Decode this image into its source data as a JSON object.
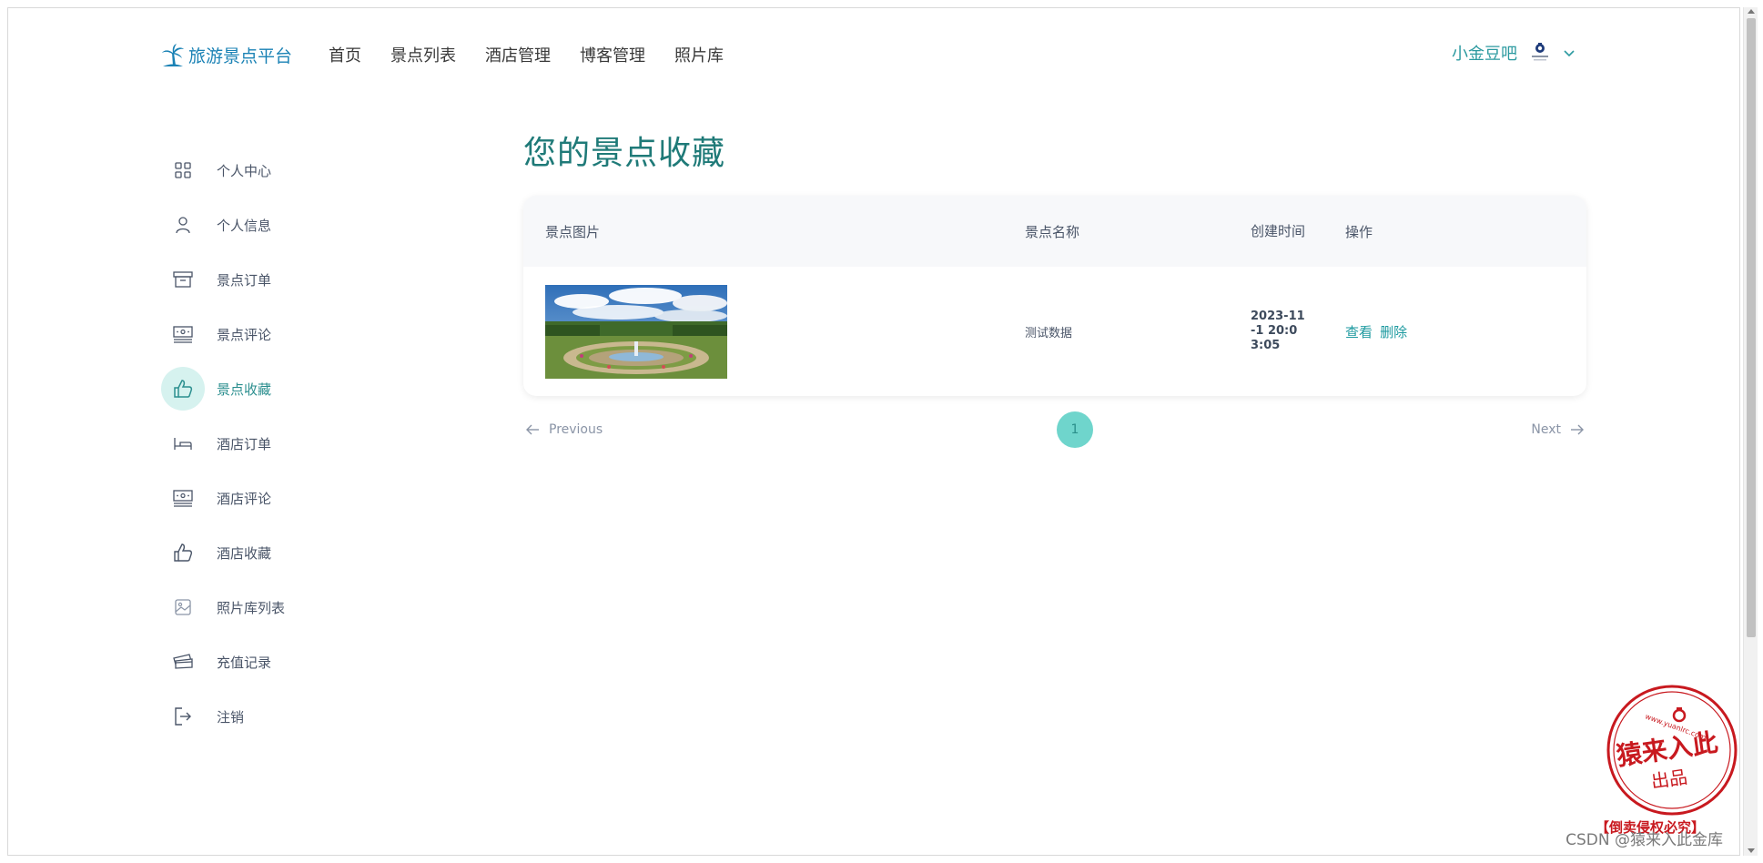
{
  "brand": {
    "name": "旅游景点平台"
  },
  "nav": {
    "items": [
      {
        "label": "首页"
      },
      {
        "label": "景点列表"
      },
      {
        "label": "酒店管理"
      },
      {
        "label": "博客管理"
      },
      {
        "label": "照片库"
      }
    ]
  },
  "user": {
    "name": "小金豆吧"
  },
  "sidebar": {
    "active_index": 4,
    "items": [
      {
        "label": "个人中心",
        "icon": "grid-icon"
      },
      {
        "label": "个人信息",
        "icon": "user-icon"
      },
      {
        "label": "景点订单",
        "icon": "archive-icon"
      },
      {
        "label": "景点评论",
        "icon": "comment-card-icon"
      },
      {
        "label": "景点收藏",
        "icon": "thumbs-up-icon"
      },
      {
        "label": "酒店订单",
        "icon": "bed-icon"
      },
      {
        "label": "酒店评论",
        "icon": "comment-card-icon"
      },
      {
        "label": "酒店收藏",
        "icon": "thumbs-up-icon"
      },
      {
        "label": "照片库列表",
        "icon": "image-icon"
      },
      {
        "label": "充值记录",
        "icon": "cards-icon"
      },
      {
        "label": "注销",
        "icon": "logout-icon"
      }
    ]
  },
  "main": {
    "title": "您的景点收藏",
    "table": {
      "headers": {
        "image": "景点图片",
        "name": "景点名称",
        "time": "创建时间",
        "ops": "操作"
      },
      "rows": [
        {
          "name": "测试数据",
          "time": "2023-11-1 20:03:05",
          "view": "查看",
          "delete": "删除"
        }
      ]
    },
    "pagination": {
      "prev": "Previous",
      "next": "Next",
      "current": "1"
    }
  },
  "stamp": {
    "text": "猿来入此",
    "sub": "出品",
    "url": "www.yuanlrc.com",
    "notice": "【倒卖侵权必究】"
  },
  "watermark": "CSDN @猿来入此金库",
  "colors": {
    "brand": "#1a82b5",
    "accent": "#2c9aa0",
    "title": "#1f7a78",
    "page_active": "#6fd5cc",
    "active_bg": "#d6f2ef"
  }
}
